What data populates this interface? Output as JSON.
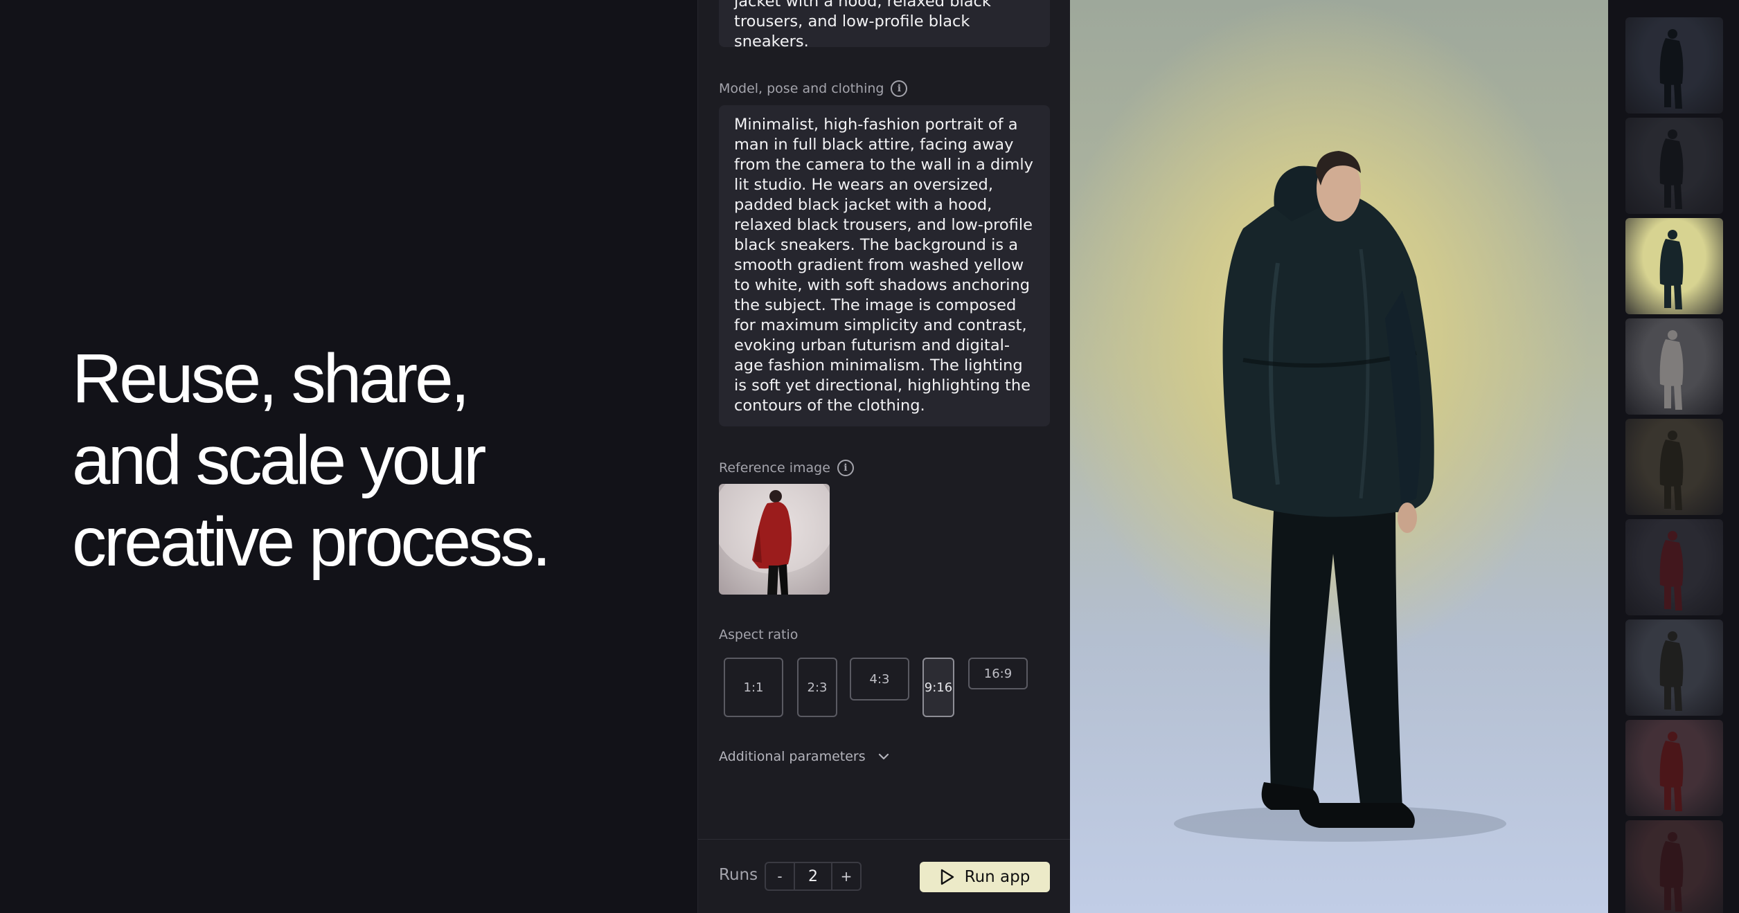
{
  "hero": {
    "lines": [
      "Reuse, share,",
      "and scale your",
      "creative process."
    ]
  },
  "form": {
    "previous_text": "jacket with a hood, relaxed black trousers, and low-profile black sneakers.",
    "model_label": "Model, pose and clothing",
    "model_text": "Minimalist, high-fashion portrait of a man in full black attire, facing away from the camera to the wall in a dimly lit studio. He wears an oversized, padded black jacket with a hood, relaxed black trousers, and low-profile black sneakers. The background is a smooth gradient from washed yellow to white, with soft shadows anchoring the subject. The image is composed for maximum simplicity and contrast, evoking urban futurism and digital-age fashion minimalism. The lighting is soft yet directional, highlighting the contours of the clothing.",
    "reference_label": "Reference image",
    "aspect_label": "Aspect ratio",
    "aspect_options": [
      "1:1",
      "2:3",
      "4:3",
      "9:16",
      "16:9"
    ],
    "aspect_selected": "9:16",
    "additional_label": "Additional parameters"
  },
  "footer": {
    "runs_label": "Runs",
    "minus": "-",
    "runs_value": "2",
    "plus": "+",
    "run_button": "Run app"
  },
  "thumbnails": {
    "active_index": 2,
    "tones": [
      "#3c4352",
      "#3a3c44",
      "#d7d391",
      "#7c7c80",
      "#5a5240",
      "#3e3e48",
      "#555a66",
      "#6b4a52",
      "#5a3a3e"
    ]
  },
  "colors": {
    "accent": "#eceac8",
    "panel": "#1c1c22",
    "background": "#121218"
  }
}
